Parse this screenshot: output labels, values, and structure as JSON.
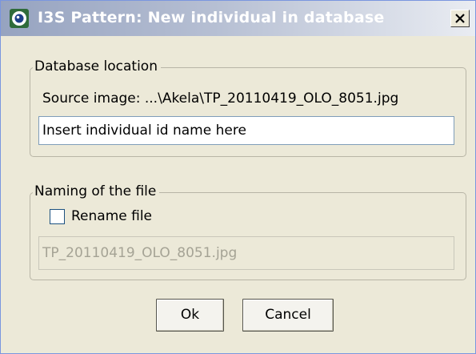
{
  "window": {
    "title": "I3S Pattern: New individual in database",
    "close_label": "X"
  },
  "database_location": {
    "group_label": "Database location",
    "source_image_text": "Source image: ...\\Akela\\TP_20110419_OLO_8051.jpg",
    "id_field_value": "Insert individual id name here"
  },
  "naming": {
    "group_label": "Naming of the file",
    "rename_label": "Rename file",
    "rename_checked": false,
    "filename_value": "TP_20110419_OLO_8051.jpg"
  },
  "buttons": {
    "ok_label": "Ok",
    "cancel_label": "Cancel"
  }
}
